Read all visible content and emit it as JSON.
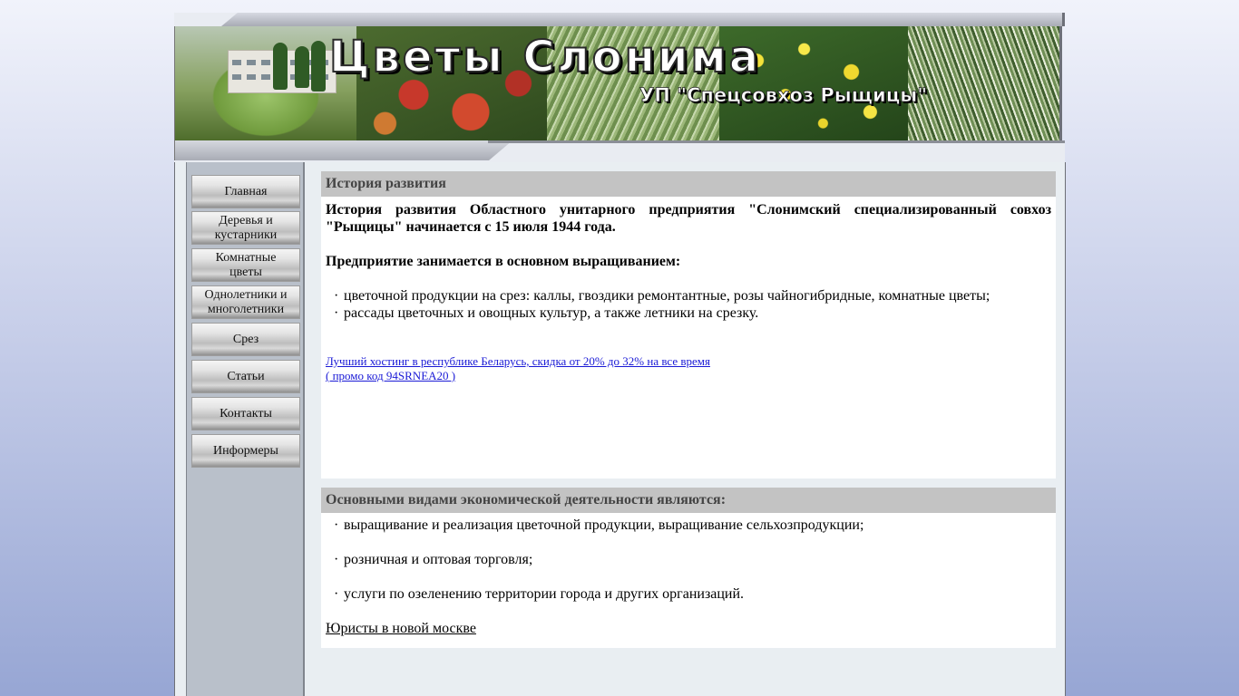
{
  "banner": {
    "title": "Цветы Слонима",
    "subtitle": "УП \"Спецсовхоз Рыщицы\""
  },
  "nav": {
    "items": [
      {
        "label": "Главная"
      },
      {
        "label": "Деревья и\nкустарники"
      },
      {
        "label": "Комнатные\nцветы"
      },
      {
        "label": "Однолетники и\nмноголетники"
      },
      {
        "label": "Срез"
      },
      {
        "label": "Статьи"
      },
      {
        "label": "Контакты"
      },
      {
        "label": "Информеры"
      }
    ]
  },
  "history": {
    "heading": "История развития",
    "intro": "История развития Областного унитарного предприятия \"Слонимский специализированный совхоз \"Рыщицы\" начинается с 15 июля 1944 года.",
    "activity_line": "Предприятие занимается в основном выращиванием:",
    "items": [
      "цветочной продукции на срез: каллы, гвоздики ремонтантные, розы чайногибридные, комнатные цветы;",
      "рассады цветочных и овощных культур, а также летники на срезку."
    ],
    "promo_line1": "Лучший хостинг в республике Беларусь, скидка от 20% до 32% на все время",
    "promo_line2": "( промо код 94SRNEA20 )"
  },
  "activities": {
    "heading": "Основными видами экономической деятельности являются:",
    "items": [
      "выращивание и реализация цветочной продукции, выращивание сельхозпродукции;",
      "розничная и оптовая торговля;",
      "услуги по озеленению территории города и других организаций."
    ],
    "link": "Юристы в новой москве"
  }
}
